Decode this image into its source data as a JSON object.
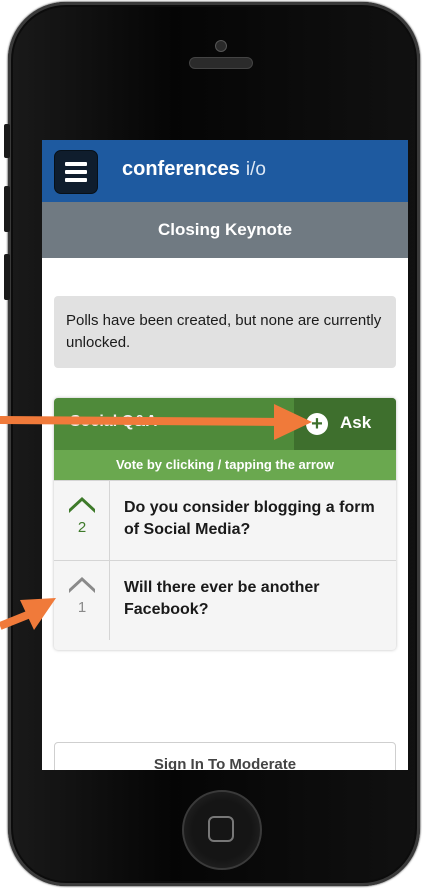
{
  "header": {
    "brand_bold": "conferences",
    "brand_light": "i/o"
  },
  "session": {
    "title": "Closing Keynote"
  },
  "polls": {
    "notice": "Polls have been created, but none are currently unlocked."
  },
  "qa": {
    "title": "Social Q&A",
    "ask_label": "Ask",
    "hint": "Vote by clicking / tapping the arrow",
    "questions": [
      {
        "count": "2",
        "text": "Do you consider blogging a form of Social Media?",
        "voted": true
      },
      {
        "count": "1",
        "text": "Will there ever be another Facebook?",
        "voted": false
      }
    ]
  },
  "footer": {
    "moderate_label": "Sign In To Moderate"
  },
  "colors": {
    "topbar": "#1e5aa0",
    "subbar": "#707a82",
    "qa_header": "#4f8a3a",
    "qa_hint": "#6aa84f",
    "voted_arrow": "#3e7a2a",
    "unvoted_arrow": "#8a8a8a",
    "annotation_arrow": "#f07a3a"
  },
  "icons": {
    "menu": "hamburger-icon",
    "ask": "plus-circle-icon",
    "vote": "chevron-up-icon",
    "home": "home-button-icon"
  }
}
